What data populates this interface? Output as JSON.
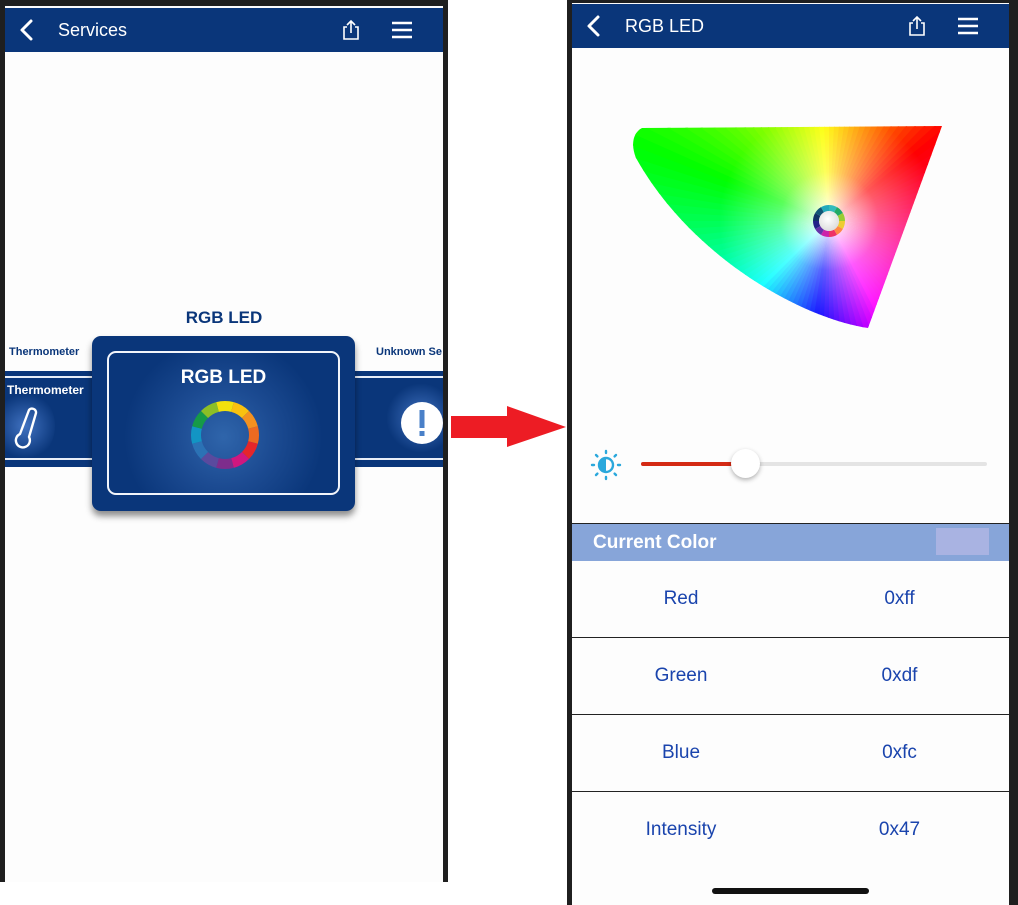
{
  "left_screen": {
    "navbar": {
      "title": "Services",
      "back_icon": "chevron-left-icon",
      "share_icon": "share-icon",
      "menu_icon": "hamburger-menu-icon"
    },
    "carousel": {
      "center_label": "RGB LED",
      "items": [
        {
          "label": "Thermometer",
          "title": "Thermometer",
          "icon": "thermometer-icon"
        },
        {
          "label": "RGB LED",
          "title": "RGB LED",
          "icon": "color-wheel-icon"
        },
        {
          "label": "Unknown Se",
          "title": "",
          "icon": "exclamation-icon"
        }
      ]
    }
  },
  "transition_arrow": {
    "icon": "arrow-right-icon",
    "color": "#ed1c24"
  },
  "right_screen": {
    "navbar": {
      "title": "RGB LED",
      "back_icon": "chevron-left-icon",
      "share_icon": "share-icon",
      "menu_icon": "hamburger-menu-icon"
    },
    "color_picker": {
      "icon": "color-gamut-picker"
    },
    "brightness": {
      "icon": "brightness-icon",
      "value_percent": 30,
      "fill_color": "#d42a14"
    },
    "current_color": {
      "title": "Current Color",
      "swatch_color": "#a9b3e2",
      "rows": [
        {
          "label": "Red",
          "value": "0xff"
        },
        {
          "label": "Green",
          "value": "0xdf"
        },
        {
          "label": "Blue",
          "value": "0xfc"
        },
        {
          "label": "Intensity",
          "value": "0x47"
        }
      ]
    }
  },
  "colors": {
    "navbar": "#0a367a",
    "text_accent": "#1a44ad",
    "header_bg": "#87a5d9"
  }
}
